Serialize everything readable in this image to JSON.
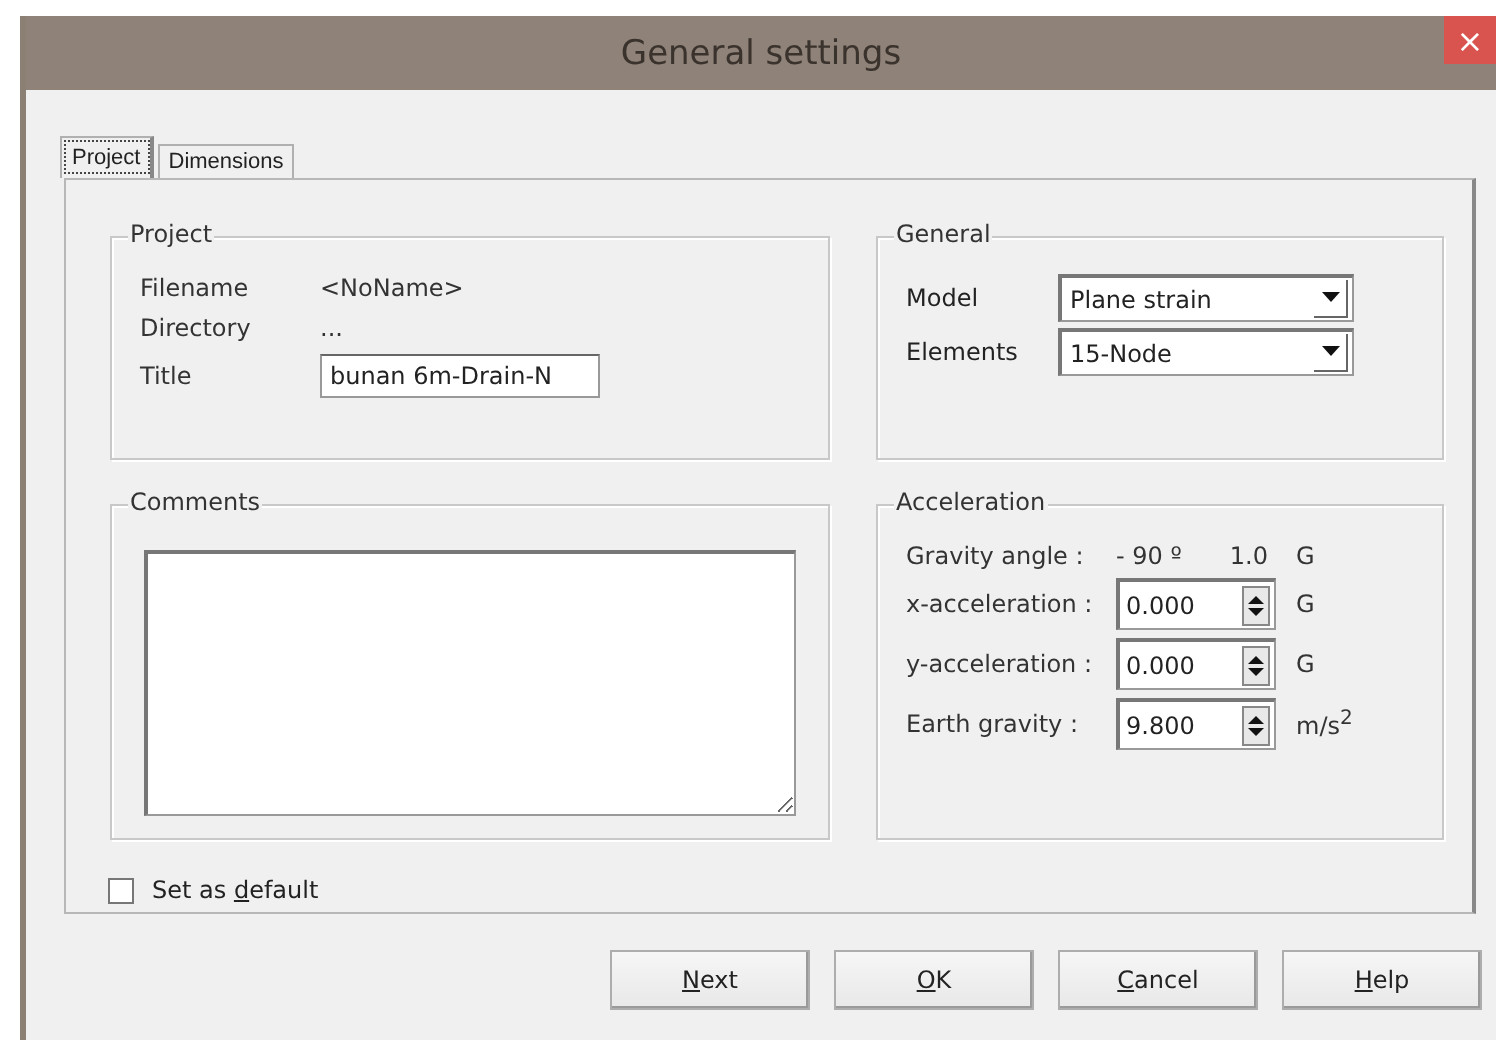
{
  "window": {
    "title": "General settings",
    "close": "×"
  },
  "tabs": [
    {
      "label": "Project",
      "selected": true
    },
    {
      "label": "Dimensions",
      "selected": false
    }
  ],
  "project": {
    "legend": "Project",
    "rows": [
      {
        "kind": "text",
        "label": "Filename",
        "value": "<NoName>"
      },
      {
        "kind": "text",
        "label": "Directory",
        "value": "..."
      },
      {
        "kind": "field",
        "label": "Title",
        "value": "bunan 6m-Drain-N"
      }
    ]
  },
  "general": {
    "legend": "General",
    "rows": [
      {
        "label": "Model",
        "value": "Plane strain"
      },
      {
        "label": "Elements",
        "value": "15-Node"
      }
    ]
  },
  "comments": {
    "legend": "Comments"
  },
  "acceleration": {
    "legend": "Acceleration",
    "rows": [
      {
        "kind": "text",
        "label": "Gravity angle :",
        "value": "- 90 º",
        "extra": "1.0",
        "unit": "G"
      },
      {
        "kind": "spin",
        "label": "x-acceleration :",
        "value": "0.000",
        "unit": "G"
      },
      {
        "kind": "spin",
        "label": "y-acceleration :",
        "value": "0.000",
        "unit": "G"
      },
      {
        "kind": "spin",
        "label": "Earth gravity :",
        "value": "9.800",
        "unit": "m/s$^{2}$"
      }
    ]
  },
  "set_as_default": {
    "label": {
      "before": "Set as ",
      "key": "d",
      "rest": "efault"
    },
    "checked": false
  },
  "buttons": [
    {
      "label": {
        "key": "N",
        "rest": "ext"
      }
    },
    {
      "label": {
        "key": "O",
        "rest": "K"
      }
    },
    {
      "label": {
        "key": "C",
        "rest": "ancel"
      }
    },
    {
      "label": {
        "key": "H",
        "rest": "elp"
      }
    }
  ]
}
